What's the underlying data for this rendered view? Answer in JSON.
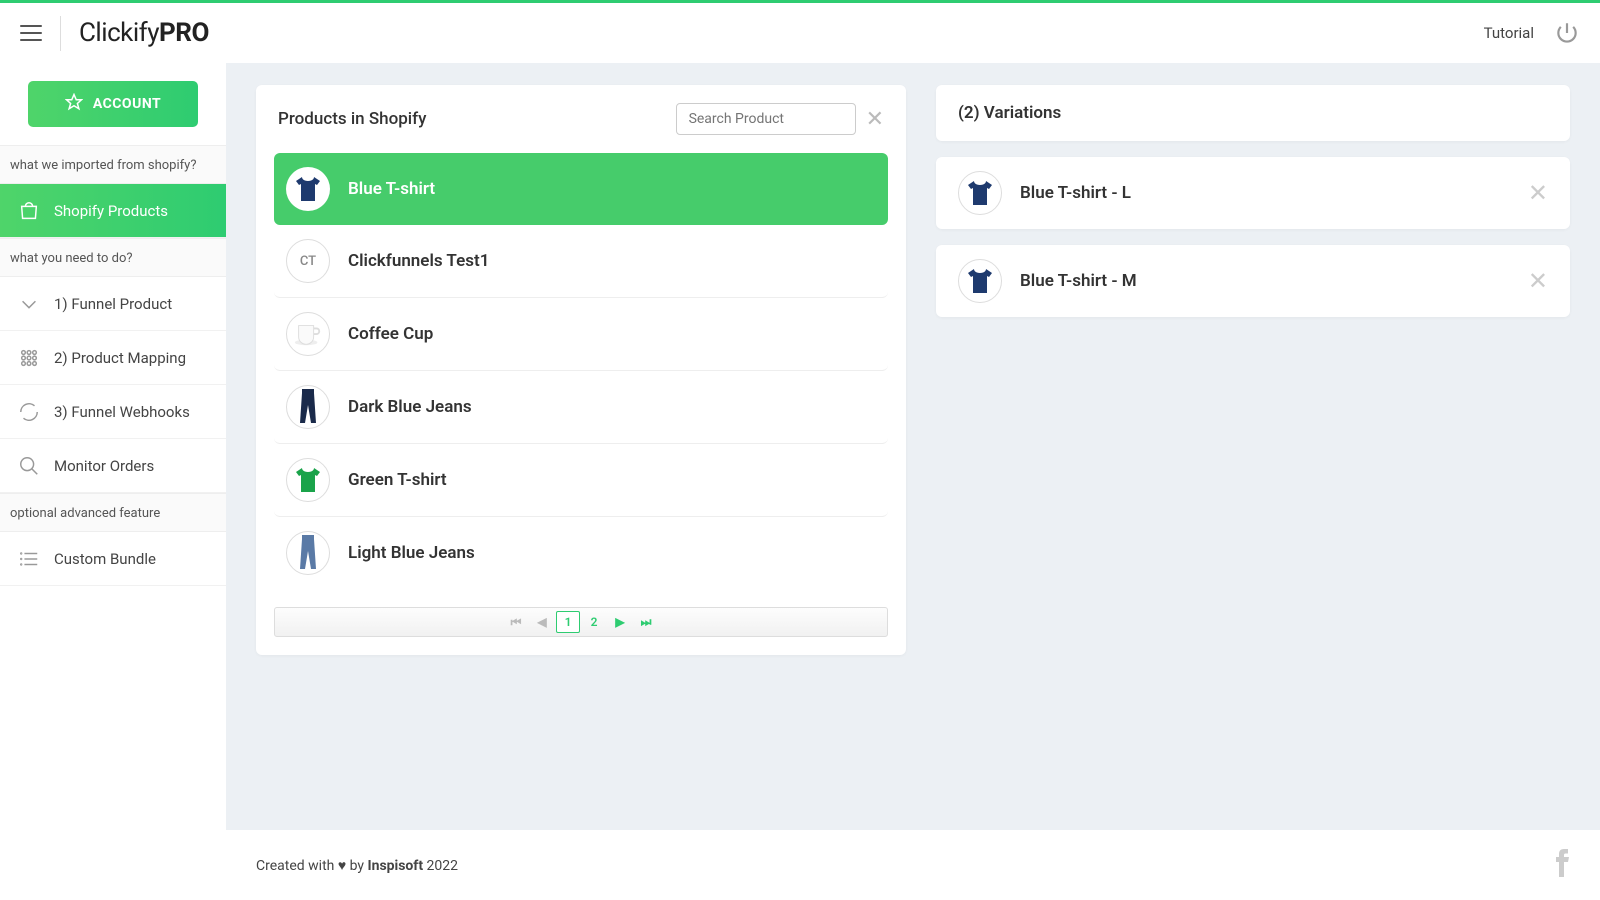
{
  "header": {
    "logo_prefix": "Clickify",
    "logo_bold": "PRO",
    "tutorial": "Tutorial"
  },
  "sidebar": {
    "account_label": "ACCOUNT",
    "section1_label": "what we imported from shopify?",
    "section2_label": "what you need to do?",
    "section3_label": "optional advanced feature",
    "items": {
      "shopify_products": "Shopify Products",
      "funnel_product": "1) Funnel Product",
      "product_mapping": "2) Product Mapping",
      "funnel_webhooks": "3) Funnel Webhooks",
      "monitor_orders": "Monitor Orders",
      "custom_bundle": "Custom Bundle"
    }
  },
  "products_panel": {
    "title": "Products in Shopify",
    "search_placeholder": "Search Product",
    "products": [
      {
        "name": "Blue T-shirt",
        "icon": "tshirt",
        "color": "#1e3a6e",
        "selected": true
      },
      {
        "name": "Clickfunnels Test1",
        "icon": "initials",
        "initials": "CT"
      },
      {
        "name": "Coffee Cup",
        "icon": "cup"
      },
      {
        "name": "Dark Blue Jeans",
        "icon": "jeans",
        "color": "#1a2a4a"
      },
      {
        "name": "Green T-shirt",
        "icon": "tshirt",
        "color": "#1aa34a"
      },
      {
        "name": "Light Blue Jeans",
        "icon": "jeans",
        "color": "#5a7aa6"
      }
    ],
    "pages": [
      "1",
      "2"
    ],
    "active_page": "1"
  },
  "variations_panel": {
    "title": "(2) Variations",
    "items": [
      {
        "name": "Blue T-shirt - L"
      },
      {
        "name": "Blue T-shirt - M"
      }
    ]
  },
  "footer": {
    "prefix": "Created with ♥ by ",
    "brand": "Inspisoft",
    "suffix": " 2022"
  }
}
